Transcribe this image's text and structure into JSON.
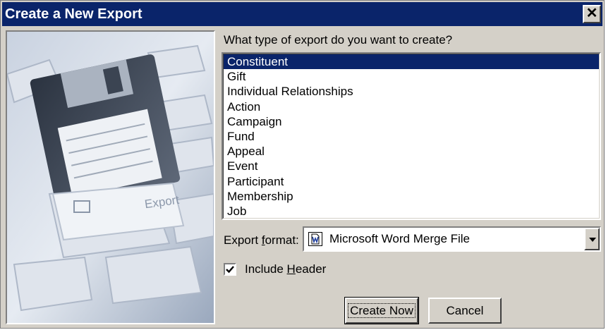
{
  "window": {
    "title": "Create a New Export",
    "close_symbol": "✕"
  },
  "prompt": "What type of export do you want to create?",
  "export_types": [
    {
      "label": "Constituent",
      "selected": true
    },
    {
      "label": "Gift"
    },
    {
      "label": "Individual Relationships"
    },
    {
      "label": "Action"
    },
    {
      "label": "Campaign"
    },
    {
      "label": "Fund"
    },
    {
      "label": "Appeal"
    },
    {
      "label": "Event"
    },
    {
      "label": "Participant"
    },
    {
      "label": "Membership"
    },
    {
      "label": "Job"
    }
  ],
  "format": {
    "label_pre": "Export ",
    "label_u": "f",
    "label_post": "ormat:",
    "value": "Microsoft Word Merge File",
    "icon": "word-document-icon"
  },
  "header_option": {
    "label_pre": "Include ",
    "label_u": "H",
    "label_post": "eader",
    "checked": true
  },
  "buttons": {
    "create_now": "Create Now",
    "cancel": "Cancel"
  },
  "image": {
    "caption": "Export"
  },
  "colors": {
    "title_bar": "#0a246a",
    "selection": "#0a246a",
    "dialog_face": "#d4d0c8"
  }
}
